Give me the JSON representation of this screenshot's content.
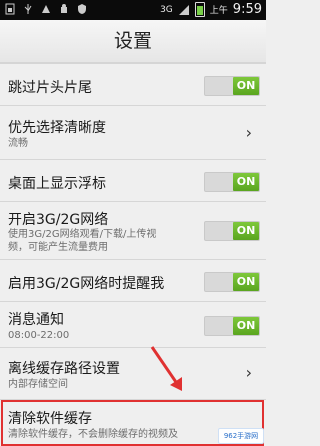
{
  "status_bar": {
    "network": "3G",
    "am_pm": "上午",
    "time": "9:59"
  },
  "header": {
    "title": "设置"
  },
  "settings": [
    {
      "label": "跳过片头片尾",
      "toggle": "ON"
    },
    {
      "label": "优先选择清晰度",
      "sub": "流畅"
    },
    {
      "label": "桌面上显示浮标",
      "toggle": "ON"
    },
    {
      "label": "开启3G/2G网络",
      "sub_lines": [
        "使用3G/2G网络观看/下载/上传视",
        "频，可能产生流量费用"
      ],
      "toggle": "ON"
    },
    {
      "label": "启用3G/2G网络时提醒我",
      "toggle": "ON"
    },
    {
      "label": "消息通知",
      "sub": "08:00-22:00",
      "toggle": "ON"
    },
    {
      "label": "离线缓存路径设置",
      "sub": "内部存储空间"
    },
    {
      "label": "清除软件缓存",
      "sub": "清除软件缓存，不会删除缓存的视频及"
    }
  ],
  "annotation": {
    "arrow_color": "#e03131",
    "box_color": "#e03131"
  },
  "watermark": {
    "text": "962手游网"
  }
}
